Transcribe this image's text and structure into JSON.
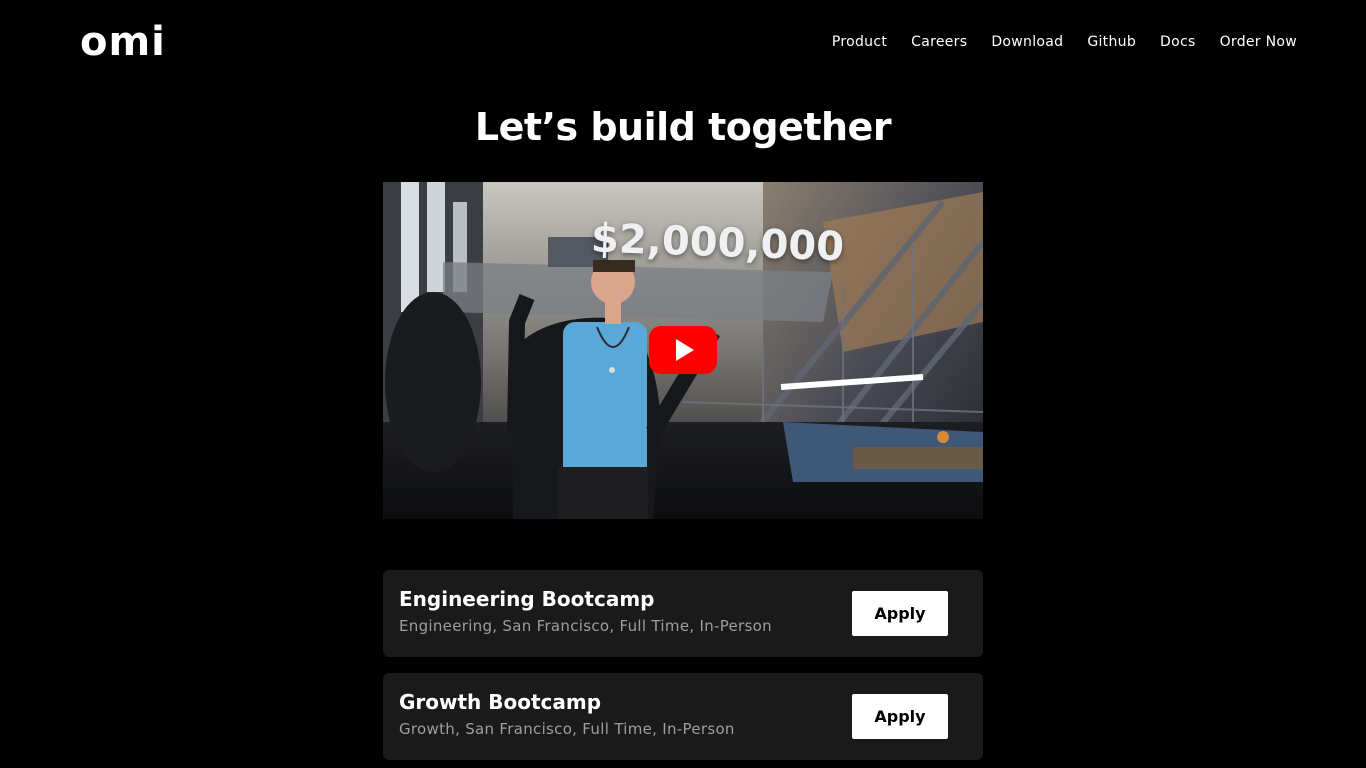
{
  "header": {
    "logo": "omi",
    "nav": [
      "Product",
      "Careers",
      "Download",
      "Github",
      "Docs",
      "Order Now"
    ]
  },
  "main": {
    "title": "Let’s build together",
    "video": {
      "overlay_text": "$2,000,000",
      "play_icon": "youtube-play-icon",
      "play_color": "#ff0000"
    },
    "jobs": [
      {
        "title": "Engineering Bootcamp",
        "meta": "Engineering, San Francisco, Full Time, In-Person",
        "button": "Apply"
      },
      {
        "title": "Growth Bootcamp",
        "meta": "Growth, San Francisco, Full Time, In-Person",
        "button": "Apply"
      }
    ]
  },
  "colors": {
    "background": "#000000",
    "card": "#1a1a1a",
    "text": "#ffffff",
    "muted": "#9e9e9e"
  }
}
